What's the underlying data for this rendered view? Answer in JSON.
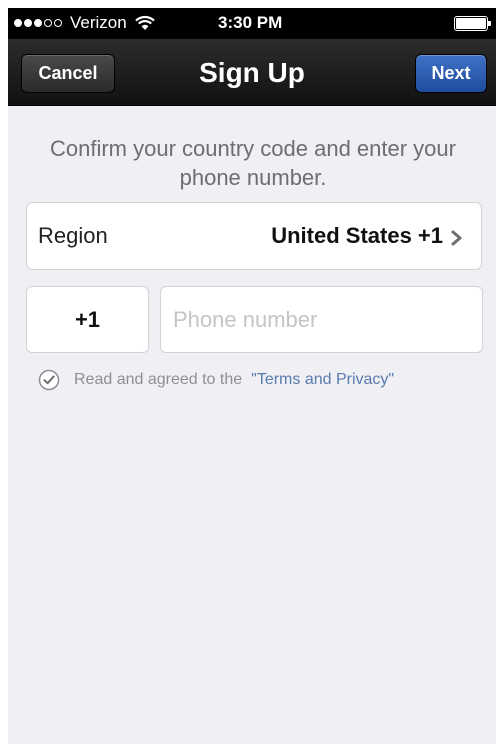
{
  "status_bar": {
    "carrier": "Verizon",
    "time": "3:30 PM",
    "signal_bars_filled": 3,
    "signal_bars_total": 5
  },
  "nav": {
    "cancel_label": "Cancel",
    "title": "Sign Up",
    "next_label": "Next"
  },
  "instructions": "Confirm your country code and enter your phone number.",
  "region": {
    "label": "Region",
    "value": "United States +1"
  },
  "phone": {
    "country_code": "+1",
    "placeholder": "Phone number",
    "value": ""
  },
  "terms": {
    "text": "Read and agreed to the",
    "link": "\"Terms and Privacy\""
  },
  "colors": {
    "nav_background": "#1a1a1a",
    "next_button": "#2a5cb0",
    "link": "#5a7ab0",
    "page_background": "#efeff4"
  }
}
